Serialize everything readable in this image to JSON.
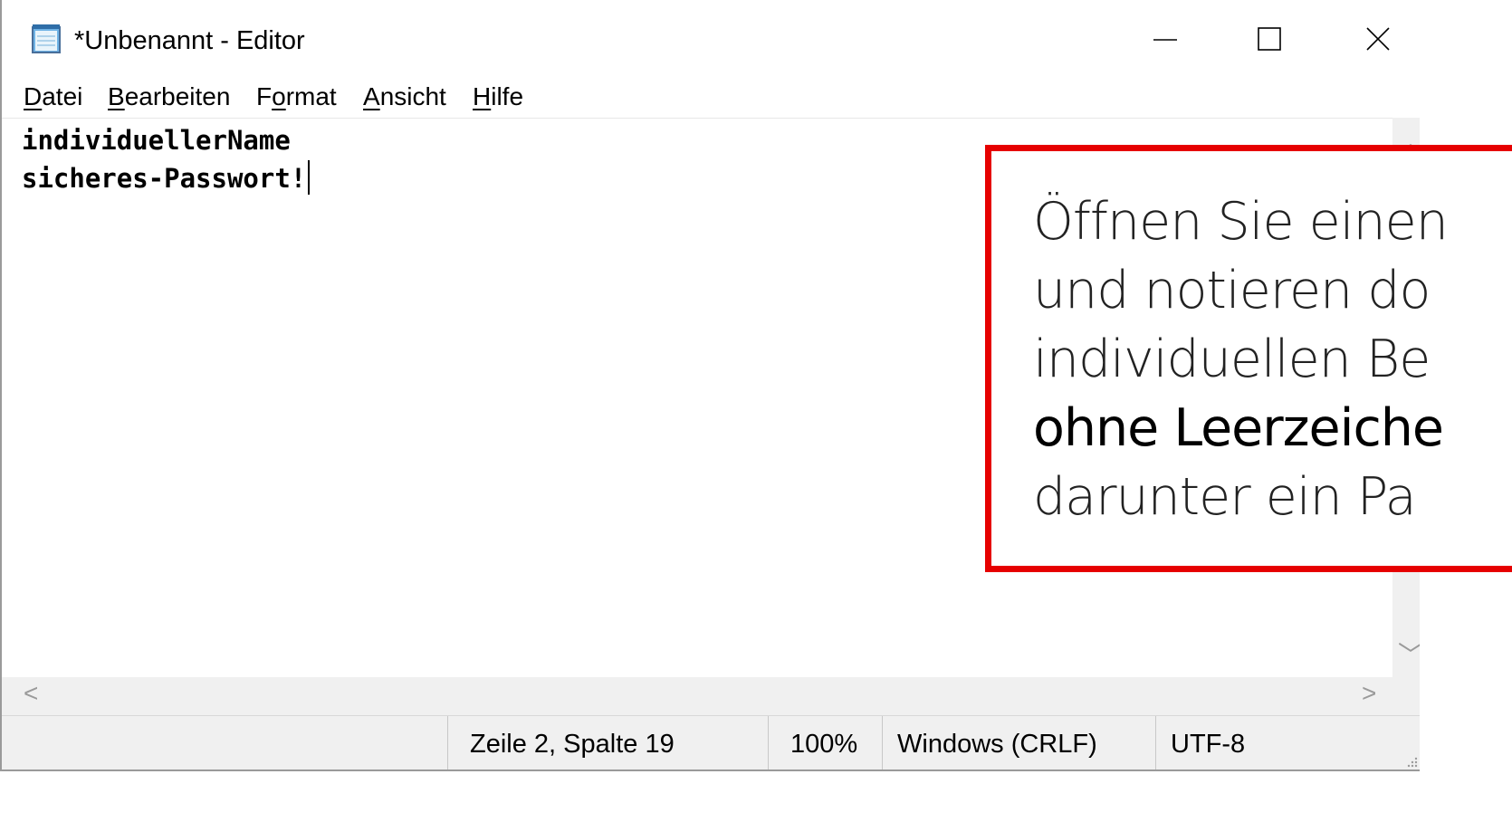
{
  "window": {
    "title": "*Unbenannt - Editor",
    "icons": {
      "app": "notepad-icon",
      "minimize": "minimize-icon",
      "maximize": "maximize-icon",
      "close": "close-icon"
    }
  },
  "menu": [
    {
      "prefix": "",
      "accel": "D",
      "suffix": "atei"
    },
    {
      "prefix": "",
      "accel": "B",
      "suffix": "earbeiten"
    },
    {
      "prefix": "F",
      "accel": "o",
      "suffix": "rmat"
    },
    {
      "prefix": "",
      "accel": "A",
      "suffix": "nsicht"
    },
    {
      "prefix": "",
      "accel": "H",
      "suffix": "ilfe"
    }
  ],
  "editor": {
    "lines": [
      "individuellerName",
      "sicheres-Passwort!"
    ]
  },
  "statusbar": {
    "position": "Zeile 2, Spalte 19",
    "zoom": "100%",
    "line_ending": "Windows (CRLF)",
    "encoding": "UTF-8"
  },
  "callout": {
    "line1": "Öffnen Sie einen",
    "line2": "und notieren do",
    "line3": "individuellen Be",
    "line4_emph": "ohne Leerzeiche",
    "line5": "darunter ein Pa",
    "border_color": "#e60000"
  }
}
